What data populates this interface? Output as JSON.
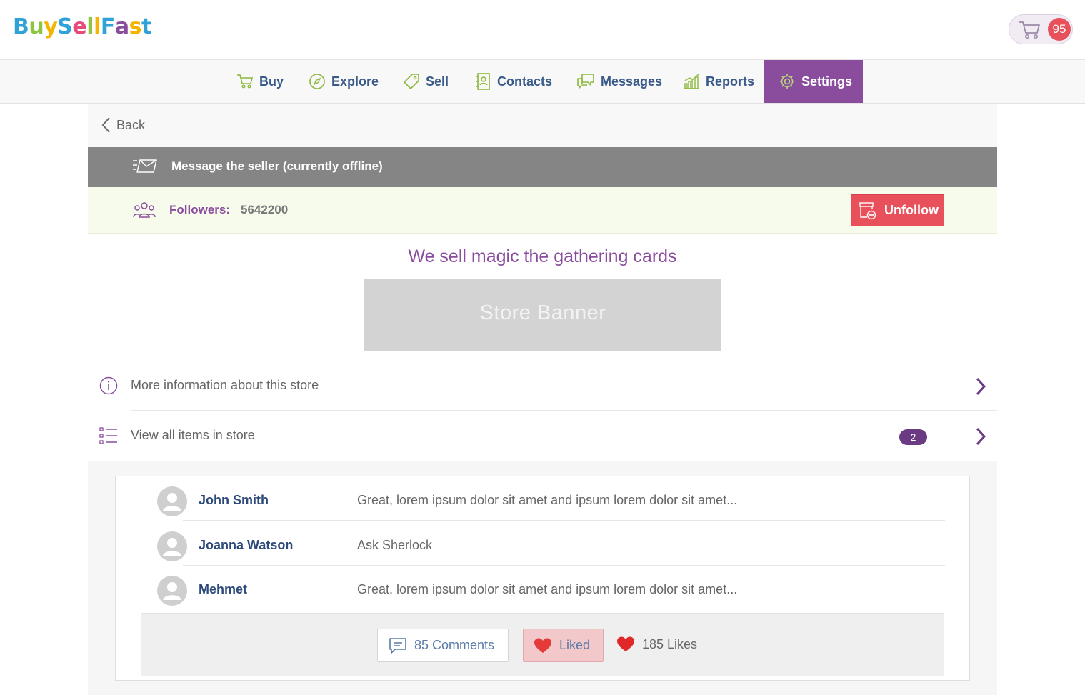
{
  "brand": {
    "logo_letters": [
      "B",
      "u",
      "y",
      "S",
      "e",
      "l",
      "l",
      "F",
      "a",
      "s",
      "t"
    ],
    "logo_colors": [
      "#2fa3d8",
      "#8cc63f",
      "#f5b400",
      "#2fa3d8",
      "#e84a7a",
      "#8cc63f",
      "#f5b400",
      "#2fa3d8",
      "#8a4d9e",
      "#f5b400",
      "#2fa3d8"
    ]
  },
  "cart": {
    "icon": "cart-icon",
    "count": "95"
  },
  "nav": {
    "items": [
      {
        "label": "Buy",
        "icon": "cart-icon"
      },
      {
        "label": "Explore",
        "icon": "compass-icon"
      },
      {
        "label": "Sell",
        "icon": "tag-icon"
      },
      {
        "label": "Contacts",
        "icon": "contacts-book-icon"
      },
      {
        "label": "Messages",
        "icon": "chat-bubbles-icon"
      },
      {
        "label": "Reports",
        "icon": "bar-chart-icon"
      },
      {
        "label": "Settings",
        "icon": "gear-icon"
      }
    ],
    "active": "Settings"
  },
  "back": {
    "label": "Back"
  },
  "message_bar": {
    "label": "Message the seller (currently offline)"
  },
  "followers": {
    "label": "Followers:",
    "count": "5642200",
    "unfollow_label": "Unfollow"
  },
  "store": {
    "title": "We sell magic the gathering cards",
    "banner_text": "Store Banner"
  },
  "links": [
    {
      "label": "More information about this store",
      "icon": "info-icon"
    },
    {
      "label": "View all items in store",
      "icon": "list-icon",
      "badge": "2"
    }
  ],
  "comments": [
    {
      "name": "John Smith",
      "text": "Great, lorem ipsum dolor sit amet and ipsum lorem dolor sit amet..."
    },
    {
      "name": "Joanna Watson",
      "text": "Ask Sherlock"
    },
    {
      "name": "Mehmet",
      "text": "Great, lorem ipsum dolor sit amet and ipsum lorem dolor sit amet..."
    }
  ],
  "actions": {
    "comments_label": "85 Comments",
    "liked_label": "Liked",
    "likes_label": "185 Likes"
  },
  "colors": {
    "accent": "#8a4d9e",
    "danger": "#e8505b",
    "nav_text": "#3a5a8a",
    "icon_green": "#8cb83c"
  }
}
